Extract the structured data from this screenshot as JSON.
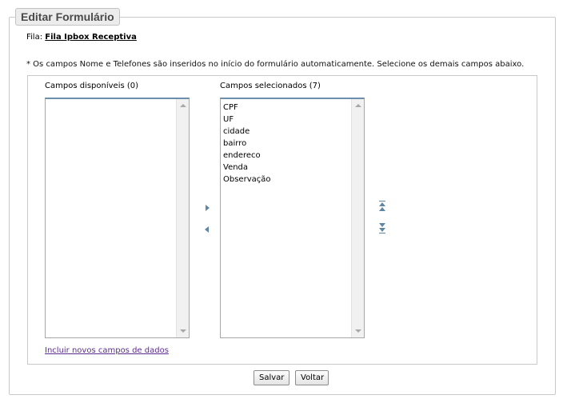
{
  "header": {
    "title": "Editar Formulário"
  },
  "fila": {
    "label": "Fila:",
    "link": "Fila Ipbox Receptiva"
  },
  "note": "* Os campos Nome e Telefones são inseridos no início do formulário automaticamente. Selecione os demais campos abaixo.",
  "available": {
    "label": "Campos disponíveis (0)",
    "items": []
  },
  "selected": {
    "label": "Campos selecionados (7)",
    "items": [
      "CPF",
      "UF",
      "cidade",
      "bairro",
      "endereco",
      "Venda",
      "Observação"
    ]
  },
  "add_link": "Incluir novos campos de dados",
  "buttons": {
    "save": "Salvar",
    "back": "Voltar"
  },
  "colors": {
    "accent": "#5f87a3",
    "link_visited": "#5b2d8f",
    "listbox_top": "#6d8fae"
  }
}
